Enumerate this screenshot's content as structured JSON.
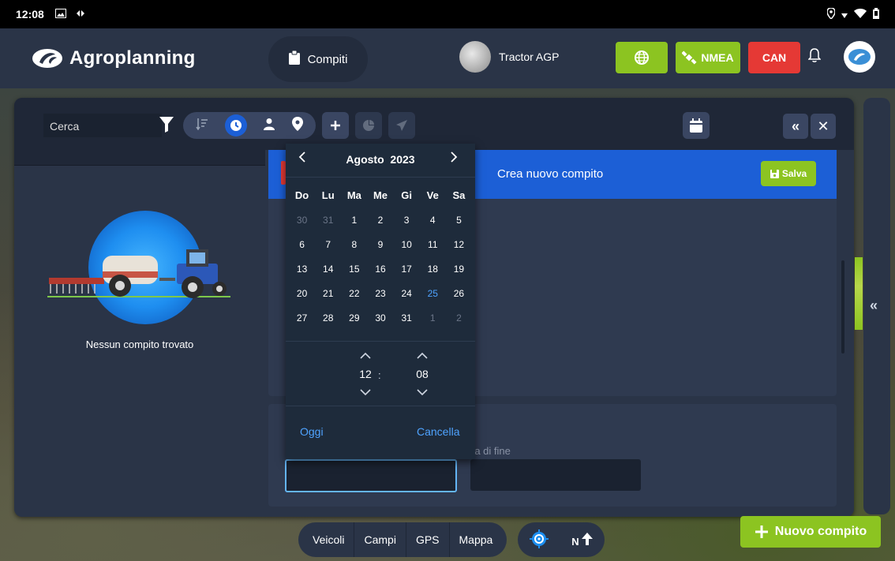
{
  "status_bar": {
    "time": "12:08"
  },
  "app": {
    "name": "Agroplanning"
  },
  "header": {
    "compiti_label": "Compiti",
    "tractor_label": "Tractor AGP",
    "nmea_label": "NMEA",
    "can_label": "CAN"
  },
  "toolbar": {
    "search_placeholder": "Cerca"
  },
  "empty_state": {
    "text": "Nessun compito trovato"
  },
  "form": {
    "title": "Crea nuovo compito",
    "save_label": "Salva",
    "end_time_label": "ra di fine"
  },
  "datepicker": {
    "month": "Agosto",
    "year": "2023",
    "weekdays": [
      "Do",
      "Lu",
      "Ma",
      "Me",
      "Gi",
      "Ve",
      "Sa"
    ],
    "weeks": [
      [
        "30",
        "31",
        "1",
        "2",
        "3",
        "4",
        "5"
      ],
      [
        "6",
        "7",
        "8",
        "9",
        "10",
        "11",
        "12"
      ],
      [
        "13",
        "14",
        "15",
        "16",
        "17",
        "18",
        "19"
      ],
      [
        "20",
        "21",
        "22",
        "23",
        "24",
        "25",
        "26"
      ],
      [
        "27",
        "28",
        "29",
        "30",
        "31",
        "1",
        "2"
      ]
    ],
    "hour": "12",
    "minute": "08",
    "separator": ":",
    "today_label": "Oggi",
    "cancel_label": "Cancella"
  },
  "bottom_nav": {
    "items": [
      "Veicoli",
      "Campi",
      "GPS",
      "Mappa"
    ],
    "north_label": "N"
  },
  "new_task_label": "Nuovo compito",
  "colors": {
    "accent_green": "#8cc421",
    "accent_blue": "#1c5fd6",
    "danger_red": "#e53935",
    "panel": "#2a3447",
    "link_blue": "#4fa3ff"
  }
}
